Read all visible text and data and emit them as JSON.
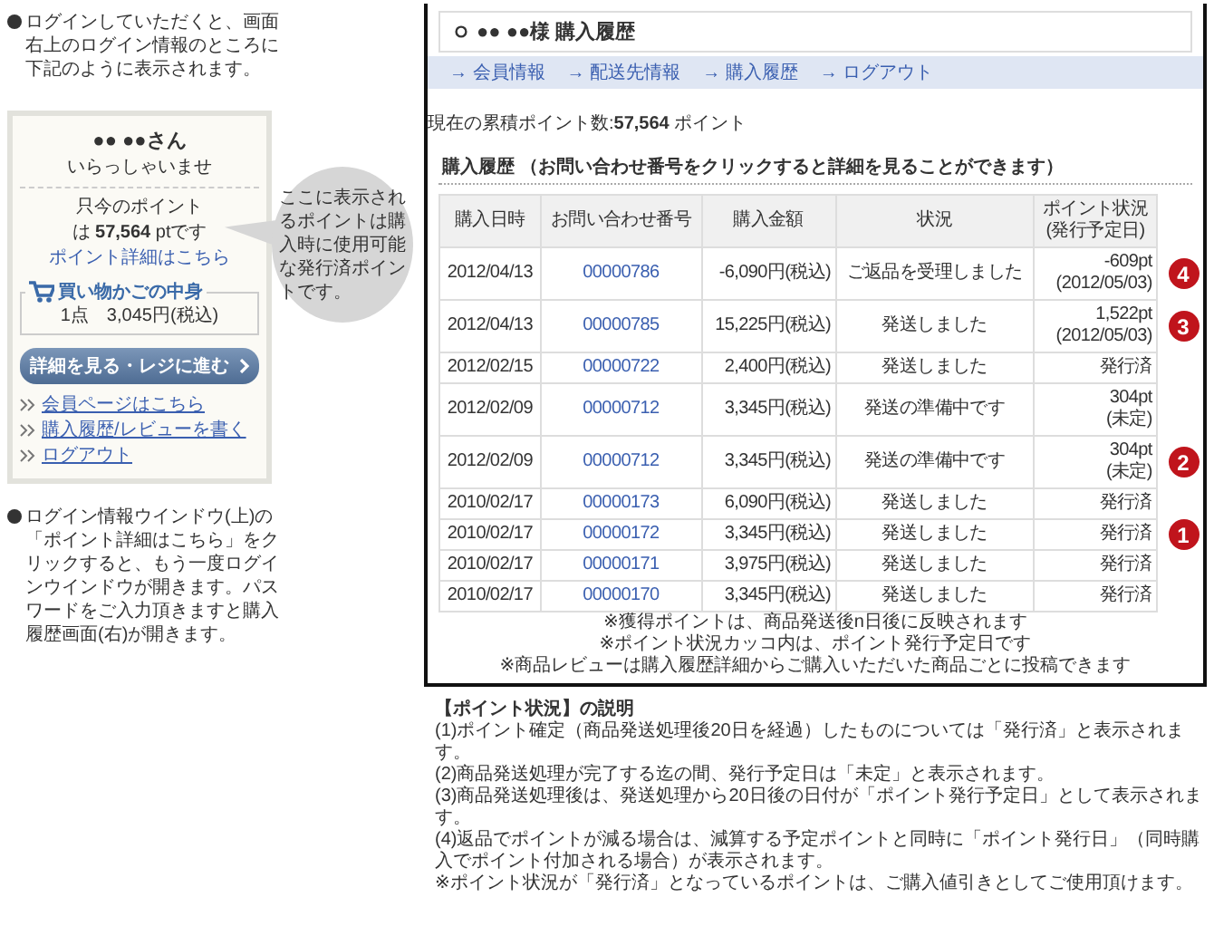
{
  "left": {
    "intro": "ログインしていただくと、画面右上のログイン情報のところに下記のように表示されます。",
    "login_box": {
      "name": "●● ●●さん",
      "greeting": "いらっしゃいませ",
      "points_label": "只今のポイント",
      "points_value": "は **57,564** ptです",
      "points_link": "ポイント詳細はこちら",
      "cart_title": "買い物かごの中身",
      "cart_summary": "1点　3,045円(税込)",
      "checkout_button": "詳細を見る・レジに進む",
      "links": [
        "会員ページはこちら",
        "購入履歴/レビューを書く",
        "ログアウト"
      ]
    },
    "callout": "ここに表示されるポイントは購入時に使用可能な発行済ポイントです。",
    "note": "ログイン情報ウインドウ(上)の「ポイント詳細はこちら」をクリックすると、もう一度ログインウインドウが開きます。パスワードをご入力頂きますと購入履歴画面(右)が開きます。"
  },
  "panel": {
    "title": "●● ●●様 購入履歴",
    "nav": [
      "→ 会員情報",
      "→ 配送先情報",
      "→ 購入履歴",
      "→ ログアウト"
    ],
    "points_summary": "現在の累積ポイント数:**57,564** ポイント",
    "section_title": "購入履歴 （お問い合わせ番号をクリックすると詳細を見ることができます）",
    "table": {
      "columns": [
        {
          "label": "購入日時"
        },
        {
          "label": "お問い合わせ番号"
        },
        {
          "label": "購入金額"
        },
        {
          "label": "状況"
        },
        {
          "label": "ポイント状況",
          "note": "(発行予定日)"
        }
      ],
      "rows": [
        {
          "date": "2012/04/13",
          "number": "00000786",
          "amount": "-6,090円(税込)",
          "status": "ご返品を受理しました",
          "points": "-609pt",
          "points_note": "(2012/05/03)",
          "marker": "4"
        },
        {
          "date": "2012/04/13",
          "number": "00000785",
          "amount": "15,225円(税込)",
          "status": "発送しました",
          "points": "1,522pt",
          "points_note": "(2012/05/03)",
          "marker": "3"
        },
        {
          "date": "2012/02/15",
          "number": "00000722",
          "amount": "2,400円(税込)",
          "status": "発送しました",
          "points": "発行済"
        },
        {
          "date": "2012/02/09",
          "number": "00000712",
          "amount": "3,345円(税込)",
          "status": "発送の準備中です",
          "points": "304pt",
          "points_note": "(未定)"
        },
        {
          "date": "2012/02/09",
          "number": "00000712",
          "amount": "3,345円(税込)",
          "status": "発送の準備中です",
          "points": "304pt",
          "points_note": "(未定)",
          "marker": "2"
        },
        {
          "date": "2010/02/17",
          "number": "00000173",
          "amount": "6,090円(税込)",
          "status": "発送しました",
          "points": "発行済"
        },
        {
          "date": "2010/02/17",
          "number": "00000172",
          "amount": "3,345円(税込)",
          "status": "発送しました",
          "points": "発行済",
          "marker": "1"
        },
        {
          "date": "2010/02/17",
          "number": "00000171",
          "amount": "3,975円(税込)",
          "status": "発送しました",
          "points": "発行済"
        },
        {
          "date": "2010/02/17",
          "number": "00000170",
          "amount": "3,345円(税込)",
          "status": "発送しました",
          "points": "発行済"
        }
      ]
    },
    "footnotes": [
      "※獲得ポイントは、商品発送後n日後に反映されます",
      "※ポイント状況カッコ内は、ポイント発行予定日です",
      "※商品レビューは購入履歴詳細からご購入いただいた商品ごとに投稿できます"
    ]
  },
  "explanation": {
    "title": "【ポイント状況】の説明",
    "lines": [
      "(1)ポイント確定（商品発送処理後20日を経過）したものについては「発行済」と表示されます。",
      "(2)商品発送処理が完了する迄の間、発行予定日は「未定」と表示されます。",
      "(3)商品発送処理後は、発送処理から20日後の日付が「ポイント発行予定日」として表示されます。",
      "(4)返品でポイントが減る場合は、減算する予定ポイントと同時に「ポイント発行日」（同時購入でポイント付加される場合）が表示されます。",
      "※ポイント状況が「発行済」となっているポイントは、ご購入値引きとしてご使用頂けます。"
    ]
  }
}
